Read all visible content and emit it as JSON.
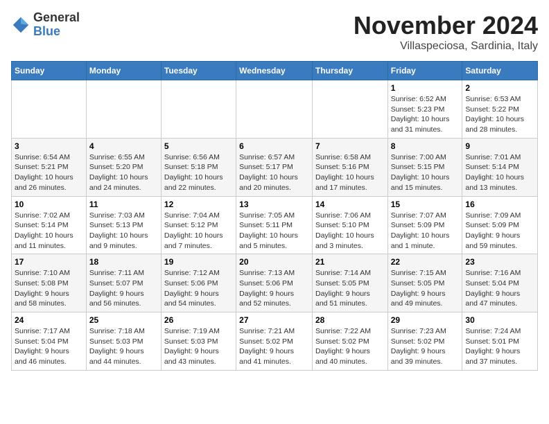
{
  "logo": {
    "line1": "General",
    "line2": "Blue"
  },
  "title": "November 2024",
  "subtitle": "Villaspeciosa, Sardinia, Italy",
  "days_header": [
    "Sunday",
    "Monday",
    "Tuesday",
    "Wednesday",
    "Thursday",
    "Friday",
    "Saturday"
  ],
  "weeks": [
    [
      {
        "day": "",
        "info": ""
      },
      {
        "day": "",
        "info": ""
      },
      {
        "day": "",
        "info": ""
      },
      {
        "day": "",
        "info": ""
      },
      {
        "day": "",
        "info": ""
      },
      {
        "day": "1",
        "info": "Sunrise: 6:52 AM\nSunset: 5:23 PM\nDaylight: 10 hours\nand 31 minutes."
      },
      {
        "day": "2",
        "info": "Sunrise: 6:53 AM\nSunset: 5:22 PM\nDaylight: 10 hours\nand 28 minutes."
      }
    ],
    [
      {
        "day": "3",
        "info": "Sunrise: 6:54 AM\nSunset: 5:21 PM\nDaylight: 10 hours\nand 26 minutes."
      },
      {
        "day": "4",
        "info": "Sunrise: 6:55 AM\nSunset: 5:20 PM\nDaylight: 10 hours\nand 24 minutes."
      },
      {
        "day": "5",
        "info": "Sunrise: 6:56 AM\nSunset: 5:18 PM\nDaylight: 10 hours\nand 22 minutes."
      },
      {
        "day": "6",
        "info": "Sunrise: 6:57 AM\nSunset: 5:17 PM\nDaylight: 10 hours\nand 20 minutes."
      },
      {
        "day": "7",
        "info": "Sunrise: 6:58 AM\nSunset: 5:16 PM\nDaylight: 10 hours\nand 17 minutes."
      },
      {
        "day": "8",
        "info": "Sunrise: 7:00 AM\nSunset: 5:15 PM\nDaylight: 10 hours\nand 15 minutes."
      },
      {
        "day": "9",
        "info": "Sunrise: 7:01 AM\nSunset: 5:14 PM\nDaylight: 10 hours\nand 13 minutes."
      }
    ],
    [
      {
        "day": "10",
        "info": "Sunrise: 7:02 AM\nSunset: 5:14 PM\nDaylight: 10 hours\nand 11 minutes."
      },
      {
        "day": "11",
        "info": "Sunrise: 7:03 AM\nSunset: 5:13 PM\nDaylight: 10 hours\nand 9 minutes."
      },
      {
        "day": "12",
        "info": "Sunrise: 7:04 AM\nSunset: 5:12 PM\nDaylight: 10 hours\nand 7 minutes."
      },
      {
        "day": "13",
        "info": "Sunrise: 7:05 AM\nSunset: 5:11 PM\nDaylight: 10 hours\nand 5 minutes."
      },
      {
        "day": "14",
        "info": "Sunrise: 7:06 AM\nSunset: 5:10 PM\nDaylight: 10 hours\nand 3 minutes."
      },
      {
        "day": "15",
        "info": "Sunrise: 7:07 AM\nSunset: 5:09 PM\nDaylight: 10 hours\nand 1 minute."
      },
      {
        "day": "16",
        "info": "Sunrise: 7:09 AM\nSunset: 5:09 PM\nDaylight: 9 hours\nand 59 minutes."
      }
    ],
    [
      {
        "day": "17",
        "info": "Sunrise: 7:10 AM\nSunset: 5:08 PM\nDaylight: 9 hours\nand 58 minutes."
      },
      {
        "day": "18",
        "info": "Sunrise: 7:11 AM\nSunset: 5:07 PM\nDaylight: 9 hours\nand 56 minutes."
      },
      {
        "day": "19",
        "info": "Sunrise: 7:12 AM\nSunset: 5:06 PM\nDaylight: 9 hours\nand 54 minutes."
      },
      {
        "day": "20",
        "info": "Sunrise: 7:13 AM\nSunset: 5:06 PM\nDaylight: 9 hours\nand 52 minutes."
      },
      {
        "day": "21",
        "info": "Sunrise: 7:14 AM\nSunset: 5:05 PM\nDaylight: 9 hours\nand 51 minutes."
      },
      {
        "day": "22",
        "info": "Sunrise: 7:15 AM\nSunset: 5:05 PM\nDaylight: 9 hours\nand 49 minutes."
      },
      {
        "day": "23",
        "info": "Sunrise: 7:16 AM\nSunset: 5:04 PM\nDaylight: 9 hours\nand 47 minutes."
      }
    ],
    [
      {
        "day": "24",
        "info": "Sunrise: 7:17 AM\nSunset: 5:04 PM\nDaylight: 9 hours\nand 46 minutes."
      },
      {
        "day": "25",
        "info": "Sunrise: 7:18 AM\nSunset: 5:03 PM\nDaylight: 9 hours\nand 44 minutes."
      },
      {
        "day": "26",
        "info": "Sunrise: 7:19 AM\nSunset: 5:03 PM\nDaylight: 9 hours\nand 43 minutes."
      },
      {
        "day": "27",
        "info": "Sunrise: 7:21 AM\nSunset: 5:02 PM\nDaylight: 9 hours\nand 41 minutes."
      },
      {
        "day": "28",
        "info": "Sunrise: 7:22 AM\nSunset: 5:02 PM\nDaylight: 9 hours\nand 40 minutes."
      },
      {
        "day": "29",
        "info": "Sunrise: 7:23 AM\nSunset: 5:02 PM\nDaylight: 9 hours\nand 39 minutes."
      },
      {
        "day": "30",
        "info": "Sunrise: 7:24 AM\nSunset: 5:01 PM\nDaylight: 9 hours\nand 37 minutes."
      }
    ]
  ]
}
